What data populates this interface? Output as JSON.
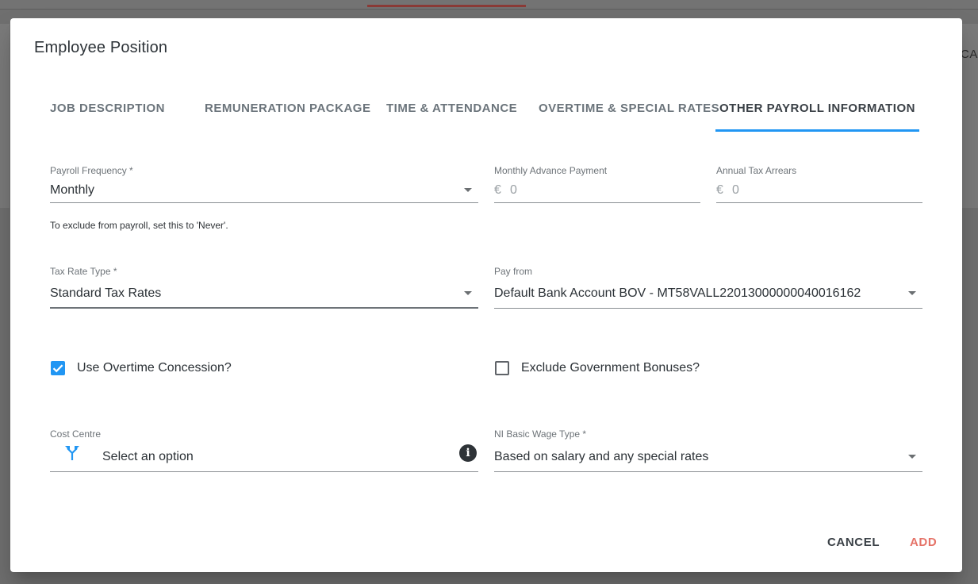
{
  "background": {
    "peek_text": "CA"
  },
  "dialog": {
    "title": "Employee Position",
    "tabs": [
      {
        "label": "JOB DESCRIPTION",
        "active": false
      },
      {
        "label": "REMUNERATION PACKAGE",
        "active": false
      },
      {
        "label": "TIME & ATTENDANCE",
        "active": false
      },
      {
        "label": "OVERTIME & SPECIAL RATES",
        "active": false
      },
      {
        "label": "OTHER PAYROLL INFORMATION",
        "active": true
      }
    ],
    "accent_color": "#2196f3",
    "form": {
      "payroll_frequency": {
        "label": "Payroll Frequency *",
        "value": "Monthly",
        "hint": "To exclude from payroll, set this to 'Never'."
      },
      "monthly_advance": {
        "label": "Monthly Advance Payment",
        "currency": "€",
        "value": "0"
      },
      "annual_tax_arrears": {
        "label": "Annual Tax Arrears",
        "currency": "€",
        "value": "0"
      },
      "tax_rate_type": {
        "label": "Tax Rate Type *",
        "value": "Standard Tax Rates"
      },
      "pay_from": {
        "label": "Pay from",
        "value": "Default Bank Account BOV - MT58VALL22013000000040016162"
      },
      "use_overtime_concession": {
        "label": "Use Overtime Concession?",
        "checked": true
      },
      "exclude_government_bonuses": {
        "label": "Exclude Government Bonuses?",
        "checked": false
      },
      "cost_centre": {
        "label": "Cost Centre",
        "placeholder": "Select an option",
        "icon": "split-arrow-icon",
        "info_icon": "info-icon"
      },
      "ni_basic_wage_type": {
        "label": "NI Basic Wage Type *",
        "value": "Based on salary and any special rates"
      }
    },
    "actions": {
      "cancel": "CANCEL",
      "add": "ADD",
      "add_color": "#e57368"
    }
  }
}
